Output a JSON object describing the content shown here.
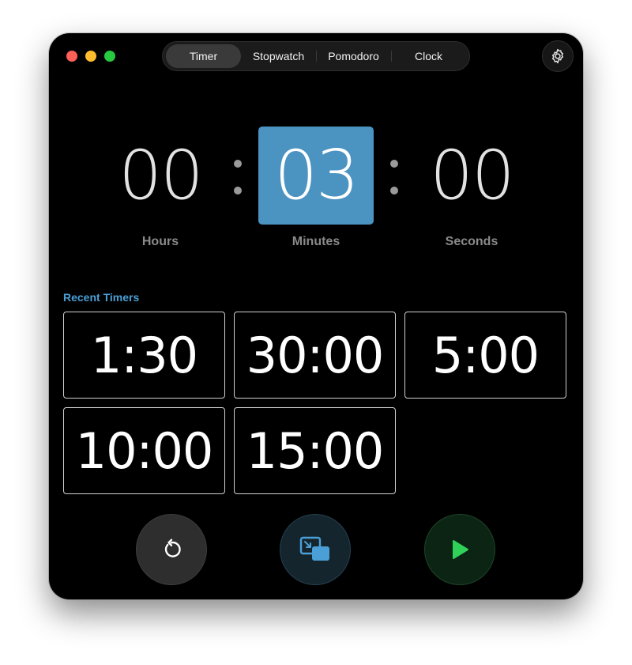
{
  "tabs": [
    {
      "label": "Timer",
      "active": true
    },
    {
      "label": "Stopwatch",
      "active": false
    },
    {
      "label": "Pomodoro",
      "active": false
    },
    {
      "label": "Clock",
      "active": false
    }
  ],
  "settings_icon": "gear-icon",
  "timer": {
    "hours": {
      "value": "00",
      "label": "Hours"
    },
    "minutes": {
      "value": "03",
      "label": "Minutes",
      "selected": true
    },
    "seconds": {
      "value": "00",
      "label": "Seconds"
    },
    "selected_color": "#4b93c0"
  },
  "recent": {
    "title": "Recent Timers",
    "items": [
      "1:30",
      "30:00",
      "5:00",
      "10:00",
      "15:00"
    ]
  },
  "controls": {
    "reset_icon": "reset-icon",
    "pip_icon": "picture-in-picture-icon",
    "play_icon": "play-icon",
    "play_color": "#2fd158",
    "accent_color": "#4a9fd6"
  }
}
